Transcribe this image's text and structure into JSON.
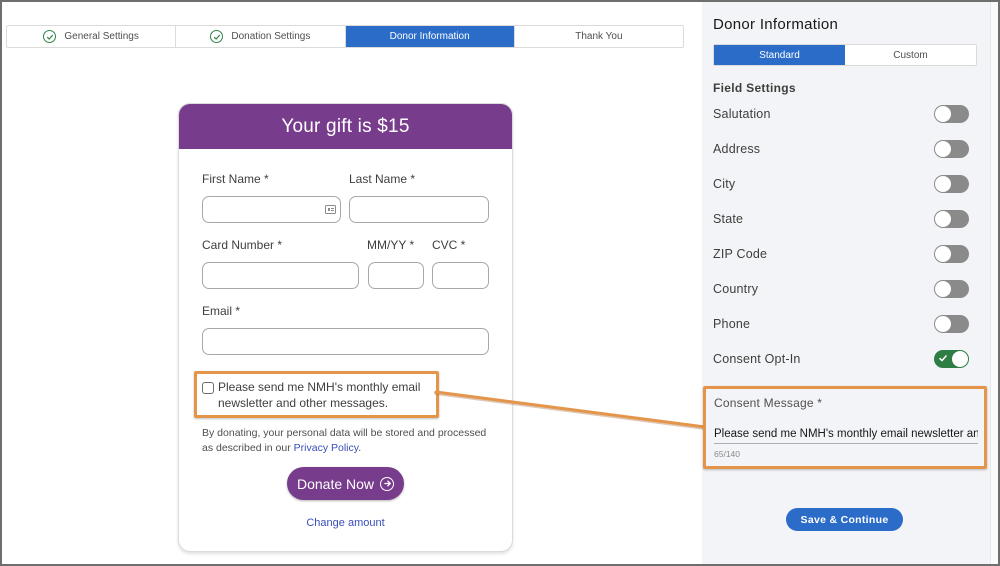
{
  "path_steps": [
    {
      "label": "General Settings",
      "state": "complete"
    },
    {
      "label": "Donation Settings",
      "state": "complete"
    },
    {
      "label": "Donor Information",
      "state": "active"
    },
    {
      "label": "Thank You",
      "state": "incomplete"
    }
  ],
  "form": {
    "header": "Your gift is $15",
    "first_name_label": "First Name *",
    "last_name_label": "Last Name *",
    "card_number_label": "Card Number *",
    "expiry_label": "MM/YY *",
    "cvc_label": "CVC *",
    "email_label": "Email *",
    "first_name_value": "",
    "last_name_value": "",
    "card_number_value": "",
    "expiry_value": "",
    "cvc_value": "",
    "email_value": "",
    "optin_checked": false,
    "optin_text": "Please send me NMH's monthly email newsletter and other messages.",
    "privacy_text": "By donating, your personal data will be stored and processed as described in our ",
    "privacy_link": "Privacy Policy",
    "privacy_end": ".",
    "donate_label": "Donate Now",
    "change_amount_label": "Change amount"
  },
  "panel": {
    "title": "Donor Information",
    "tabs": [
      {
        "label": "Standard",
        "active": true
      },
      {
        "label": "Custom",
        "active": false
      }
    ],
    "section_label": "Field Settings",
    "fields": [
      {
        "label": "Salutation",
        "enabled": false
      },
      {
        "label": "Address",
        "enabled": false
      },
      {
        "label": "City",
        "enabled": false
      },
      {
        "label": "State",
        "enabled": false
      },
      {
        "label": "ZIP Code",
        "enabled": false
      },
      {
        "label": "Country",
        "enabled": false
      },
      {
        "label": "Phone",
        "enabled": false
      },
      {
        "label": "Consent Opt-In",
        "enabled": true
      }
    ],
    "consent_message_label": "Consent Message *",
    "consent_message_value": "Please send me NMH's monthly email newsletter and other messages.",
    "consent_message_count": "65/140",
    "save_label": "Save & Continue"
  },
  "colors": {
    "brand_purple": "#783c8c",
    "active_blue": "#2a6cc8",
    "highlight_orange": "#e5954a",
    "toggle_on_green": "#2e7d44",
    "complete_green": "#2e844a"
  }
}
